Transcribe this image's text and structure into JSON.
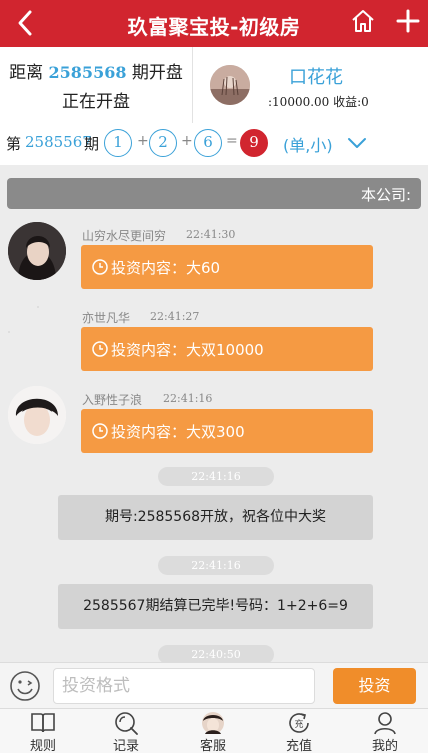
{
  "header": {
    "title": "玖富聚宝投-初级房",
    "back_icon": "chevron-left-icon",
    "home_icon": "home-icon",
    "plus_icon": "plus-icon"
  },
  "info": {
    "countdown_prefix": "距离 ",
    "next_period": "2585568",
    "countdown_suffix": " 期开盘",
    "status": "正在开盘",
    "user_name": "口花花",
    "balance_text": ":10000.00 收益:0"
  },
  "draw": {
    "prefix": "第",
    "period": "2585567",
    "suffix": "期",
    "balls": [
      "1",
      "2",
      "6"
    ],
    "plus": "+",
    "equals": "=",
    "sum": "9",
    "result_type": "(单,小)"
  },
  "company": {
    "label": "本公司:"
  },
  "messages": [
    {
      "name": "山穷水尽更间穷",
      "time": "22:41:30",
      "content": "投资内容：大60"
    },
    {
      "name": "亦世凡华",
      "time": "22:41:27",
      "content": "投资内容：大双10000"
    },
    {
      "name": "入野性子浪",
      "time": "22:41:16",
      "content": "投资内容：大双300"
    }
  ],
  "system": [
    {
      "time": "22:41:16",
      "text": "期号:2585568开放，祝各位中大奖"
    },
    {
      "time": "22:41:16",
      "text": "2585567期结算已完毕!号码：1+2+6=9"
    },
    {
      "time": "22:40:50"
    }
  ],
  "input": {
    "placeholder": "投资格式",
    "send_label": "投资"
  },
  "nav": [
    {
      "label": "规则",
      "icon": "book-icon"
    },
    {
      "label": "记录",
      "icon": "search-icon"
    },
    {
      "label": "客服",
      "icon": "service-avatar-icon"
    },
    {
      "label": "充值",
      "icon": "recharge-icon"
    },
    {
      "label": "我的",
      "icon": "user-icon"
    }
  ],
  "colors": {
    "brand_red": "#d1252f",
    "accent_blue": "#3aa1d8",
    "bubble_orange": "#f59a43",
    "button_orange": "#f08d2a"
  }
}
